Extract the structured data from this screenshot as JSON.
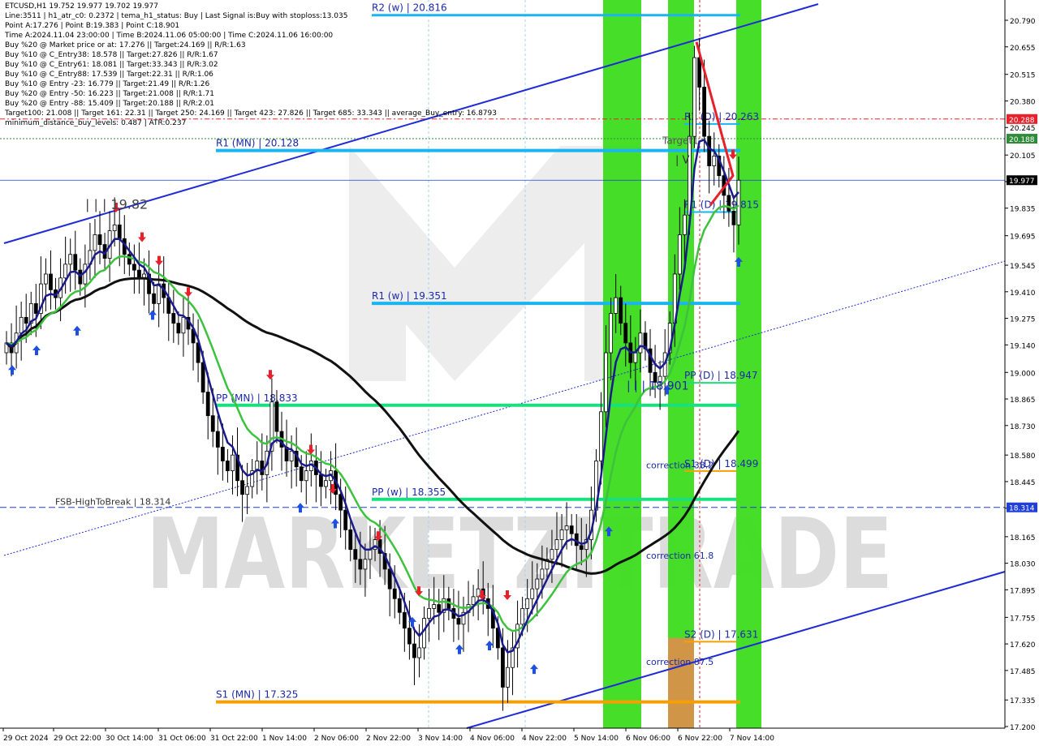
{
  "info": {
    "lines": [
      "ETCUSD,H1  19.752 19.977 19.702 19.977",
      "Line:3511 | h1_atr_c0: 0.2372 | tema_h1_status: Buy | Last Signal is:Buy with stoploss:13.035",
      "Point A:17.276 | Point B:19.383 | Point C:18.901",
      "Time A:2024.11.04 23:00:00 | Time B:2024.11.06 05:00:00 | Time C:2024.11.06 16:00:00",
      "Buy %20 @ Market price or at: 17.276 || Target:24.169 || R/R:1.63",
      "Buy %10 @ C_Entry38: 18.578 || Target:27.826 || R/R:1.67",
      "Buy %10 @ C_Entry61: 18.081 || Target:33.343 || R/R:3.02",
      "Buy %10 @ C_Entry88: 17.539 || Target:22.31 || R/R:1.06",
      "Buy %10 @ Entry -23: 16.779 || Target:21.49 || R/R:1.26",
      "Buy %20 @ Entry -50: 16.223 || Target:21.008 || R/R:1.71",
      "Buy %20 @ Entry -88: 15.409 || Target:20.188 || R/R:2.01",
      "Target100: 21.008 || Target 161: 22.31 || Target 250: 24.169 || Target 423: 27.826 || Target 685: 33.343 || average_Buy_entry: 16.8793",
      "minimum_distance_buy_levels: 0.487 | ATR:0.237"
    ]
  },
  "watermark": {
    "text": "MARKETZITRADE"
  },
  "chart_data": {
    "type": "candlestick",
    "symbol": "ETCUSD",
    "timeframe": "H1",
    "ylim": [
      17.2,
      20.85
    ],
    "y_ticks": [
      "20.790",
      "20.655",
      "20.515",
      "20.380",
      "20.245",
      "20.105",
      "19.970",
      "19.835",
      "19.695",
      "19.545",
      "19.410",
      "19.275",
      "19.140",
      "19.000",
      "18.865",
      "18.730",
      "18.580",
      "18.445",
      "18.310",
      "18.165",
      "18.030",
      "17.895",
      "17.755",
      "17.620",
      "17.485",
      "17.335",
      "17.200"
    ],
    "x_ticks": [
      "29 Oct 2024",
      "29 Oct 22:00",
      "30 Oct 14:00",
      "31 Oct 06:00",
      "31 Oct 22:00",
      "1 Nov 14:00",
      "2 Nov 06:00",
      "2 Nov 22:00",
      "3 Nov 14:00",
      "4 Nov 06:00",
      "4 Nov 22:00",
      "5 Nov 14:00",
      "6 Nov 06:00",
      "6 Nov 22:00",
      "7 Nov 14:00"
    ],
    "price_tags": [
      {
        "label": "20.288",
        "value": 20.288,
        "color": "#e8202a"
      },
      {
        "label": "20.188",
        "value": 20.188,
        "color": "#2e8b3a"
      },
      {
        "label": "19.977",
        "value": 19.977,
        "color": "#000000"
      },
      {
        "label": "18.314",
        "value": 18.314,
        "color": "#1f3fd6"
      }
    ],
    "levels": [
      {
        "label": "R2 (w) | 20.816",
        "value": 20.816,
        "color": "#1ab4f0"
      },
      {
        "label": "R2 (D) | 20.263",
        "value": 20.263,
        "color": "#1ab4f0"
      },
      {
        "label": "R1 (MN) | 20.128",
        "value": 20.128,
        "color": "#1ab4f0"
      },
      {
        "label": "R1 (D) | 19.815",
        "value": 19.815,
        "color": "#1ab4f0"
      },
      {
        "label": "R1 (w) | 19.351",
        "value": 19.351,
        "color": "#1ab4f0"
      },
      {
        "label": "PP (D) | 18.947",
        "value": 18.947,
        "color": "#19e07e"
      },
      {
        "label": "PP (MN) | 18.833",
        "value": 18.833,
        "color": "#19e07e"
      },
      {
        "label": "S1 (D) | 18.499",
        "value": 18.499,
        "color": "#f5a000"
      },
      {
        "label": "PP (w) | 18.355",
        "value": 18.355,
        "color": "#19e07e"
      },
      {
        "label": "S2 (D) | 17.631",
        "value": 17.631,
        "color": "#f5a000"
      },
      {
        "label": "S1 (MN) | 17.325",
        "value": 17.325,
        "color": "#f5a000"
      }
    ],
    "annotations": [
      {
        "label": "FSB-HighToBreak | 18.314",
        "value": 18.314
      },
      {
        "label": "| | | 19.82",
        "value": 19.82
      },
      {
        "label": "| | | 18.901",
        "value": 18.901
      },
      {
        "label": "Target1",
        "value": 20.15
      },
      {
        "label": "| V",
        "value": 20.05
      },
      {
        "label": "correction 38.2",
        "value": 18.5
      },
      {
        "label": "correction 61.8",
        "value": 18.04
      },
      {
        "label": "correction 87.5",
        "value": 17.5
      }
    ],
    "pattern_points": {
      "A": 17.276,
      "B": 19.383,
      "C": 18.901
    },
    "series": [
      {
        "name": "candles",
        "values": [
          19.15,
          19.1,
          19.2,
          19.28,
          19.25,
          19.35,
          19.3,
          19.45,
          19.5,
          19.42,
          19.38,
          19.48,
          19.55,
          19.6,
          19.52,
          19.45,
          19.55,
          19.62,
          19.7,
          19.65,
          19.58,
          19.72,
          19.75,
          19.68,
          19.6,
          19.55,
          19.52,
          19.48,
          19.5,
          19.4,
          19.35,
          19.45,
          19.38,
          19.3,
          19.25,
          19.2,
          19.28,
          19.22,
          19.15,
          19.05,
          18.9,
          18.78,
          18.7,
          18.62,
          18.55,
          18.5,
          18.58,
          18.45,
          18.38,
          18.42,
          18.5,
          18.55,
          18.48,
          18.6,
          18.85,
          18.7,
          18.62,
          18.55,
          18.6,
          18.52,
          18.45,
          18.5,
          18.55,
          18.48,
          18.42,
          18.45,
          18.5,
          18.38,
          18.3,
          18.2,
          18.1,
          18.05,
          18.0,
          18.05,
          18.1,
          18.15,
          18.08,
          18.0,
          17.9,
          17.85,
          17.78,
          17.7,
          17.62,
          17.55,
          17.6,
          17.75,
          17.8,
          17.82,
          17.78,
          17.85,
          17.8,
          17.75,
          17.72,
          17.78,
          17.82,
          17.86,
          17.9,
          17.85,
          17.8,
          17.7,
          17.6,
          17.4,
          17.5,
          17.6,
          17.72,
          17.8,
          17.85,
          17.9,
          17.95,
          18.0,
          18.05,
          18.1,
          18.15,
          18.2,
          18.22,
          18.18,
          18.12,
          18.1,
          18.15,
          18.3,
          18.55,
          18.8,
          19.1,
          19.3,
          19.38,
          19.25,
          19.15,
          19.05,
          19.1,
          19.2,
          19.12,
          19.0,
          18.95,
          18.98,
          19.1,
          19.25,
          19.5,
          19.7,
          19.8,
          20.2,
          20.6,
          20.45,
          20.2,
          20.05,
          20.1,
          20.0,
          19.9,
          19.82,
          19.75,
          19.977
        ]
      },
      {
        "name": "EMA fast (navy)",
        "values": []
      },
      {
        "name": "EMA mid (green)",
        "values": []
      },
      {
        "name": "SMA slow (black)",
        "values": []
      }
    ]
  }
}
